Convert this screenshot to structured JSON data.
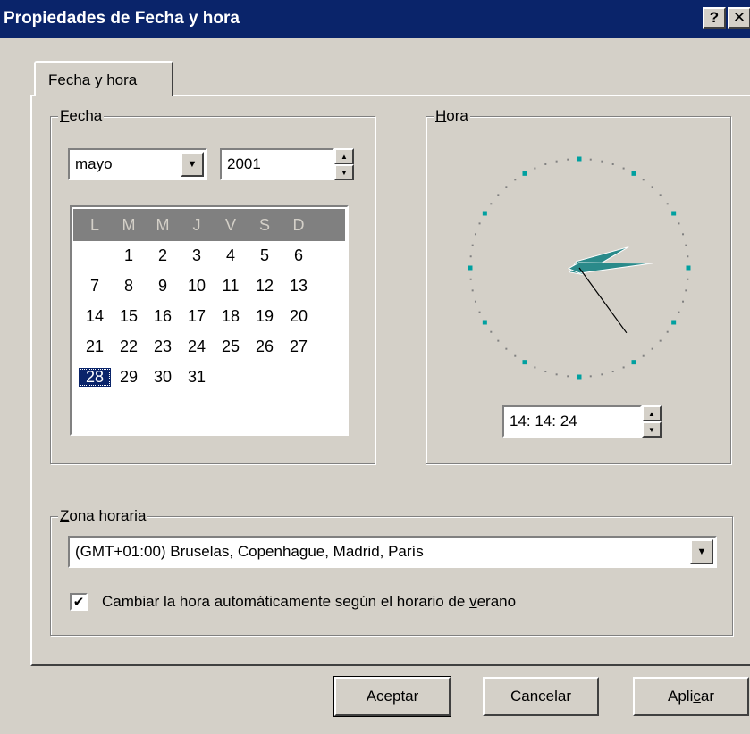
{
  "window": {
    "title": "Propiedades de Fecha y hora",
    "help_label": "?",
    "close_label": "✕"
  },
  "tabs": [
    {
      "label": "Fecha y hora",
      "active": true
    }
  ],
  "date_group": {
    "label_accel": "F",
    "label_rest": "echa",
    "month": "mayo",
    "year": "2001",
    "weekdays": [
      "L",
      "M",
      "M",
      "J",
      "V",
      "S",
      "D"
    ],
    "weeks": [
      [
        "",
        "1",
        "2",
        "3",
        "4",
        "5",
        "6"
      ],
      [
        "7",
        "8",
        "9",
        "10",
        "11",
        "12",
        "13"
      ],
      [
        "14",
        "15",
        "16",
        "17",
        "18",
        "19",
        "20"
      ],
      [
        "21",
        "22",
        "23",
        "24",
        "25",
        "26",
        "27"
      ],
      [
        "28",
        "29",
        "30",
        "31",
        "",
        "",
        ""
      ]
    ],
    "selected_day": "28"
  },
  "time_group": {
    "label_accel": "H",
    "label_rest": "ora",
    "time": "14: 14: 24",
    "clock": {
      "hour": 14,
      "minute": 14,
      "second": 24
    }
  },
  "timezone_group": {
    "label_accel": "Z",
    "label_rest": "ona horaria",
    "selected": "(GMT+01:00) Bruselas, Copenhague, Madrid, París",
    "dst_checked": true,
    "dst_label_before": "Cambiar la hora automáticamente según el horario de ",
    "dst_label_accel": "v",
    "dst_label_after": "erano"
  },
  "buttons": {
    "ok": "Aceptar",
    "cancel": "Cancelar",
    "apply_before": "Apli",
    "apply_accel": "c",
    "apply_after": "ar"
  },
  "colors": {
    "titlebar": "#0a246a",
    "clock_hands": "#2a8a8a",
    "clock_markers": "#00a0a0",
    "face": "#d4d0c8"
  },
  "icons": {
    "dropdown": "▼",
    "spin_up": "▲",
    "spin_down": "▼",
    "check": "✔"
  }
}
